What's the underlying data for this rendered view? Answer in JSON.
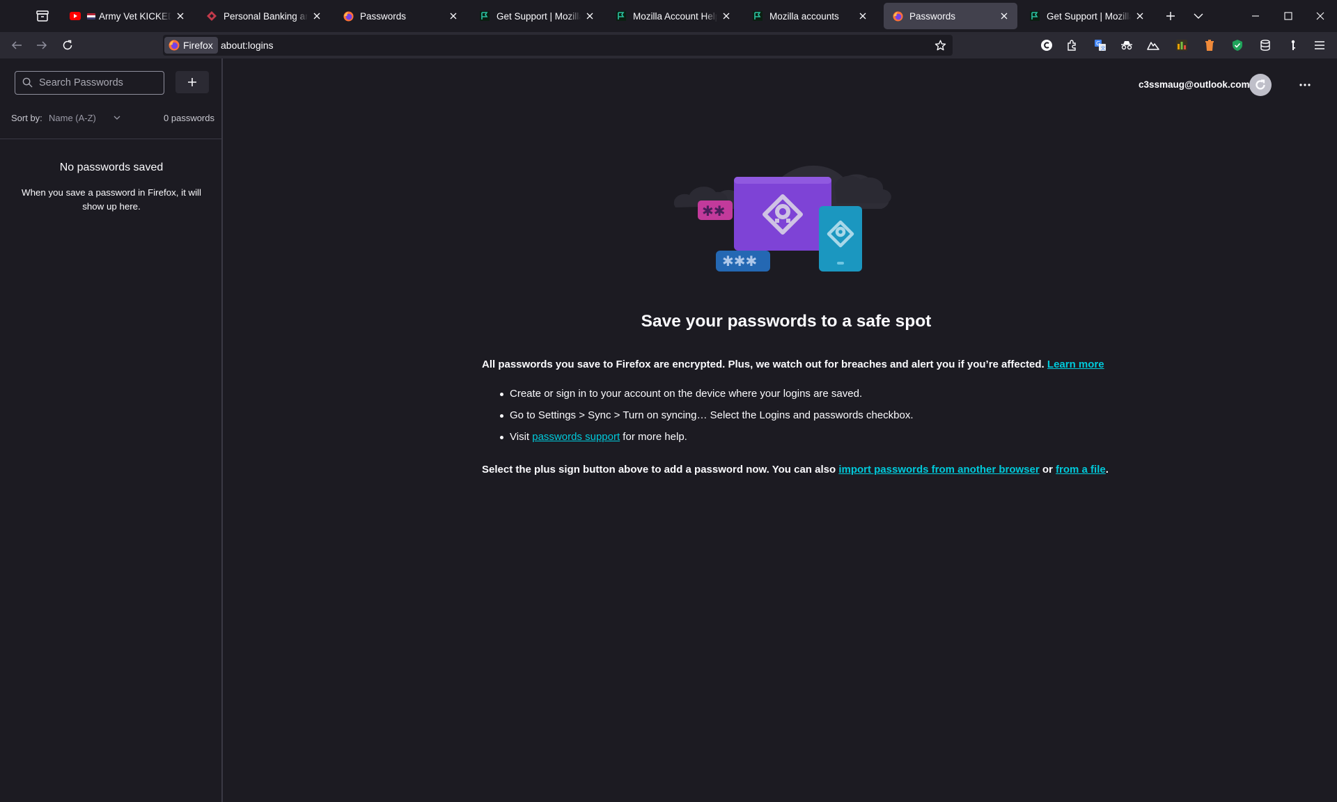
{
  "tabs": [
    {
      "title": "Army Vet KICKED OUT",
      "favicon": "youtube-icon",
      "active": false
    },
    {
      "title": "Personal Banking and Fina",
      "favicon": "bank-icon",
      "active": false
    },
    {
      "title": "Passwords",
      "favicon": "firefox-icon",
      "active": false
    },
    {
      "title": "Get Support | Mozilla Supp",
      "favicon": "mozilla-icon",
      "active": false
    },
    {
      "title": "Mozilla Account Help",
      "favicon": "mozilla-icon",
      "active": false
    },
    {
      "title": "Mozilla accounts",
      "favicon": "mozilla-icon",
      "active": false
    },
    {
      "title": "Passwords",
      "favicon": "firefox-icon",
      "active": true
    },
    {
      "title": "Get Support | Mozilla Supp",
      "favicon": "mozilla-icon",
      "active": false
    }
  ],
  "urlbar": {
    "identity_label": "Firefox",
    "url": "about:logins"
  },
  "sidebar": {
    "search_placeholder": "Search Passwords",
    "sort_label": "Sort by:",
    "sort_value": "Name (A-Z)",
    "count": "0 passwords",
    "empty_title": "No passwords saved",
    "empty_desc": "When you save a password in Firefox, it will show up here."
  },
  "account": {
    "email": "c3ssmaug@outlook.com"
  },
  "main": {
    "headline": "Save your passwords to a safe spot",
    "intro_text": "All passwords you save to Firefox are encrypted. Plus, we watch out for breaches and alert you if you’re affected. ",
    "intro_link": "Learn more",
    "step1": "Create or sign in to your account on the device where your logins are saved.",
    "step2": "Go to Settings > Sync > Turn on syncing… Select the Logins and passwords checkbox.",
    "step3_prefix": "Visit ",
    "step3_link": "passwords support",
    "step3_suffix": " for more help.",
    "import_prefix": "Select the plus sign button above to add a password now. You can also ",
    "import_link1": "import passwords from another browser",
    "import_mid": " or ",
    "import_link2": "from a file",
    "import_suffix": "."
  },
  "colors": {
    "background": "#1c1b22",
    "toolbar": "#2b2a33",
    "link": "#00cadb",
    "active_tab": "#42414d"
  }
}
